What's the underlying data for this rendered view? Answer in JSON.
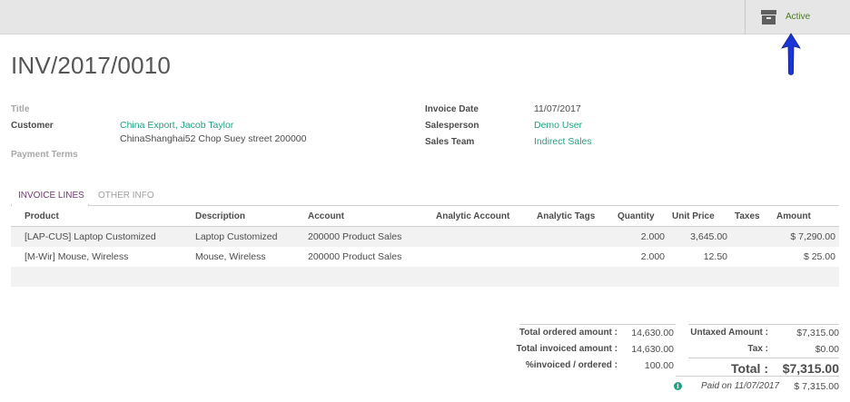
{
  "topbar": {
    "status_label": "Active",
    "status_icon": "archive-icon",
    "status_color": "#4a7a1f"
  },
  "annotation": {
    "icon": "arrow-up-icon",
    "color": "#1a36d8"
  },
  "document": {
    "title": "INV/2017/0010"
  },
  "fields": {
    "title_label": "Title",
    "customer_label": "Customer",
    "customer_name": "China Export, Jacob Taylor",
    "customer_address": "ChinaShanghai52 Chop Suey street 200000",
    "payment_terms_label": "Payment Terms",
    "invoice_date_label": "Invoice Date",
    "invoice_date": "11/07/2017",
    "salesperson_label": "Salesperson",
    "salesperson": "Demo User",
    "sales_team_label": "Sales Team",
    "sales_team": "Indirect Sales"
  },
  "tabs": [
    {
      "label": "INVOICE LINES"
    },
    {
      "label": "OTHER INFO"
    }
  ],
  "table": {
    "columns": [
      "Product",
      "Description",
      "Account",
      "Analytic Account",
      "Analytic Tags",
      "Quantity",
      "Unit Price",
      "Taxes",
      "Amount"
    ],
    "rows": [
      {
        "product": "[LAP-CUS] Laptop Customized",
        "description": "Laptop Customized",
        "account": "200000 Product Sales",
        "analytic_account": "",
        "analytic_tags": "",
        "quantity": "2.000",
        "unit_price": "3,645.00",
        "taxes": "",
        "amount": "$ 7,290.00"
      },
      {
        "product": "[M-Wir] Mouse, Wireless",
        "description": "Mouse, Wireless",
        "account": "200000 Product Sales",
        "analytic_account": "",
        "analytic_tags": "",
        "quantity": "2.000",
        "unit_price": "12.50",
        "taxes": "",
        "amount": "$ 25.00"
      }
    ]
  },
  "order_totals": {
    "ordered_label": "Total ordered amount :",
    "ordered_value": "14,630.00",
    "invoiced_label": "Total invoiced amount :",
    "invoiced_value": "14,630.00",
    "ratio_label": "%invoiced / ordered :",
    "ratio_value": "100.00"
  },
  "totals": {
    "untaxed_label": "Untaxed Amount :",
    "untaxed_value": "$7,315.00",
    "tax_label": "Tax :",
    "tax_value": "$0.00",
    "total_label": "Total :",
    "total_value": "$7,315.00",
    "paid_label": "Paid on 11/07/2017",
    "paid_value": "$ 7,315.00",
    "paid_icon": "info-icon"
  }
}
